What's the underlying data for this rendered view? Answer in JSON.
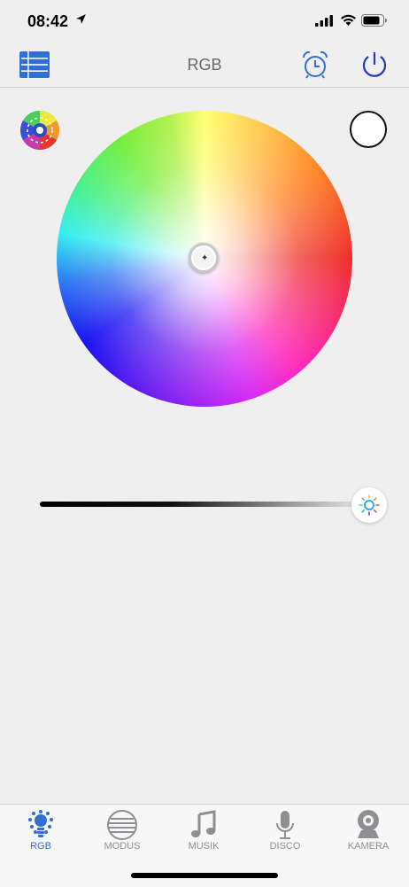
{
  "status_bar": {
    "time": "08:42"
  },
  "nav": {
    "title": "RGB"
  },
  "brightness": {
    "level": 1.0
  },
  "colors": {
    "accent": "#2f6fd6",
    "tab_inactive": "#8e8e93"
  },
  "tabs": [
    {
      "label": "RGB",
      "icon": "bulb-icon",
      "active": true
    },
    {
      "label": "MODUS",
      "icon": "modes-icon",
      "active": false
    },
    {
      "label": "MUSIK",
      "icon": "music-note-icon",
      "active": false
    },
    {
      "label": "DISCO",
      "icon": "microphone-icon",
      "active": false
    },
    {
      "label": "KAMERA",
      "icon": "camera-icon",
      "active": false
    }
  ]
}
